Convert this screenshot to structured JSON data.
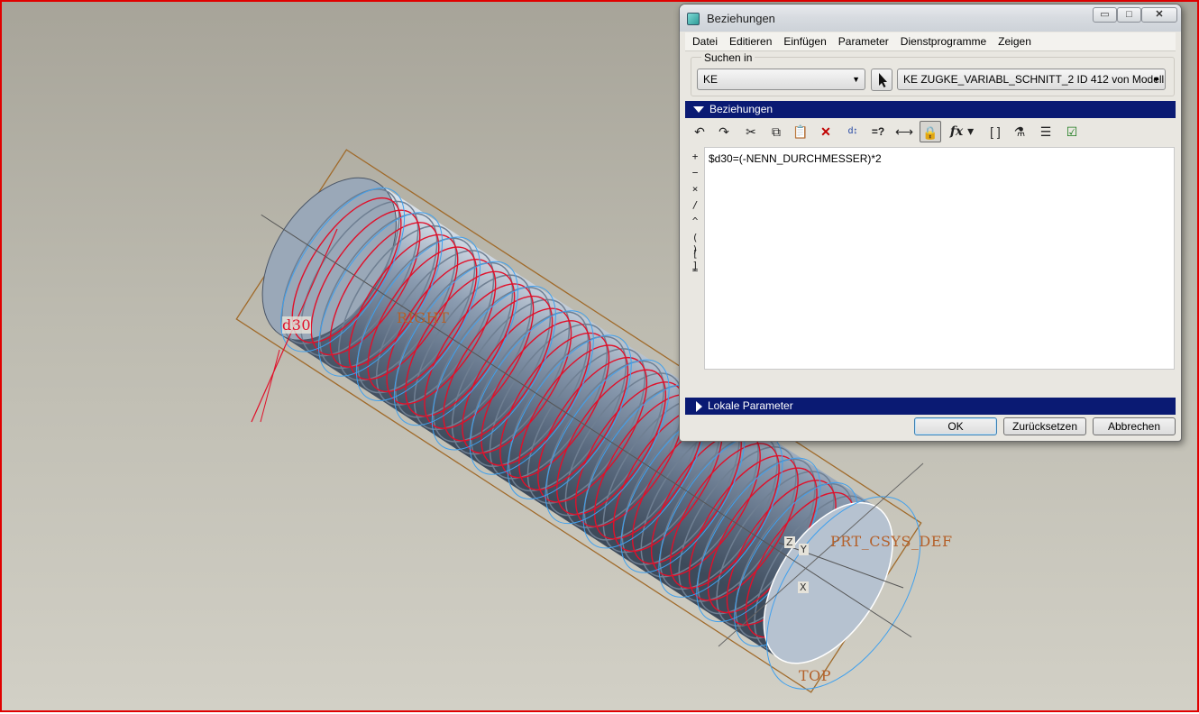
{
  "viewport": {
    "labels": {
      "dimension": "d30",
      "right_plane": "RIGHT",
      "top_plane": "TOP",
      "csys": "PRT_CSYS_DEF",
      "axis_z": "Z",
      "axis_y": "Y",
      "axis_x": "X"
    },
    "colors": {
      "frame_border": "#e00000",
      "curve_red": "#e0102a",
      "curve_blue": "#3fa0ee",
      "datum_label": "#b4602a"
    }
  },
  "dialog": {
    "title": "Beziehungen",
    "window_buttons": {
      "minimize": "▭",
      "maximize": "□",
      "close": "✕"
    },
    "menu": [
      "Datei",
      "Editieren",
      "Einfügen",
      "Parameter",
      "Dienstprogramme",
      "Zeigen"
    ],
    "search": {
      "label": "Suchen in",
      "type_value": "KE",
      "feature_value": "KE ZUGKE_VARIABL_SCHNITT_2 ID 412 von Modell"
    },
    "relations_section": "Beziehungen",
    "toolbar_icons": [
      "undo-icon",
      "redo-icon",
      "cut-icon",
      "copy-icon",
      "paste-icon",
      "delete-icon",
      "switch-dimensions-icon",
      "evaluate-icon",
      "show-dimension-icon",
      "highlight-icon",
      "function-icon",
      "brackets-icon",
      "verify-icon",
      "sort-icon",
      "execute-icon"
    ],
    "operators": [
      "+",
      "−",
      "×",
      "/",
      "^",
      "( )",
      "[ ]",
      "="
    ],
    "relation_text": "$d30=(-NENN_DURCHMESSER)*2",
    "local_params_section": "Lokale Parameter",
    "buttons": {
      "ok": "OK",
      "reset": "Zurücksetzen",
      "cancel": "Abbrechen"
    }
  }
}
